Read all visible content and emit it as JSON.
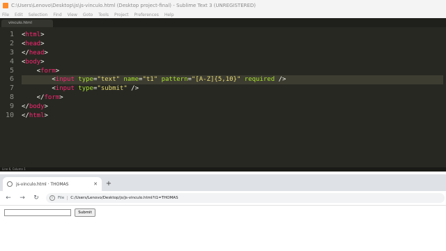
{
  "window": {
    "title": "C:\\Users\\Lenovo\\Desktop\\js\\js-vinculo.html (Desktop project-final) - Sublime Text 3 (UNREGISTERED)"
  },
  "menu": [
    "File",
    "Edit",
    "Selection",
    "Find",
    "View",
    "Goto",
    "Tools",
    "Project",
    "Preferences",
    "Help"
  ],
  "editor": {
    "tab_label": "vinculo.html",
    "line_numbers": [
      "1",
      "2",
      "3",
      "4",
      "5",
      "6",
      "7",
      "8",
      "9",
      "10"
    ],
    "status_text": "Line 6, Column 1"
  },
  "browser": {
    "tab_title": "js-vinculo.html · THOMAS",
    "new_tab_symbol": "+",
    "scheme_label": "File",
    "url": "C:/Users/Lenovo/Desktop/js/js-vinculo.html?t1=THOMAS",
    "page": {
      "submit_label": "Submit",
      "text_value": ""
    }
  },
  "colors": {
    "editor_bg": "#272822",
    "tag": "#f92672",
    "attribute": "#a6e22e",
    "string": "#e6db74"
  },
  "icons": [
    "sublime-app-icon",
    "page-icon",
    "close-icon",
    "back-arrow-icon",
    "forward-arrow-icon",
    "reload-icon",
    "info-icon"
  ]
}
